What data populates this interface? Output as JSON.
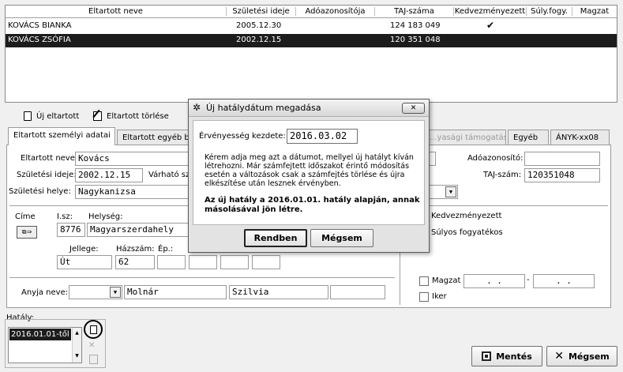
{
  "table": {
    "columns": [
      "Eltartott neve",
      "Születési ideje",
      "Adóazonosítója",
      "TAJ-száma",
      "Kedvezményezett",
      "Súly.fogy.",
      "Magzat"
    ],
    "rows": [
      {
        "name": "KOVÁCS BIANKA",
        "birth": "2005.12.30",
        "tax": "",
        "taj": "124 183 049",
        "kedv": "✔",
        "suly": "",
        "magzat": ""
      },
      {
        "name": "KOVÁCS ZSÓFIA",
        "birth": "2002.12.15",
        "tax": "",
        "taj": "120 351 048",
        "kedv": "",
        "suly": "",
        "magzat": ""
      }
    ]
  },
  "toolbar": {
    "new_label": "Új eltartott",
    "delete_label": "Eltartott törlése"
  },
  "tabs": [
    "Eltartott személyi adatai",
    "Eltartott egyéb be",
    "...yasági támogatás",
    "Egyéb",
    "ÁNYK-xx08"
  ],
  "form": {
    "name_label": "Eltartott neve:",
    "name_value": "Kovács",
    "birth_label": "Születési ideje:",
    "birth_value": "2002.12.15",
    "expected_label": "Várható sz",
    "birthplace_label": "Születési helye:",
    "birthplace_value": "Nagykanizsa",
    "tax_label": "Adóazonosító:",
    "tax_value": "",
    "taj_label": "TAJ-szám:",
    "taj_value": "120351048",
    "address_label": "Címe",
    "zip_label": "I.sz:",
    "zip_value": "8776",
    "city_label": "Helység:",
    "city_value": "Magyarszerdahely",
    "type_label": "Jellege:",
    "type_value": "Út",
    "house_label": "Házszám:",
    "house_value": "62",
    "building_label": "Ép.:",
    "mother_label": "Anyja neve:",
    "mother_last": "Molnár",
    "mother_first": "Szilvia",
    "kedv_label": "Kedvezményezett",
    "suly_label": "Súlyos fogyatékos",
    "magzat_label": "Magzat",
    "iker_label": "Iker",
    "date_mask": ". ."
  },
  "hatalyok": {
    "label": "Hatály:",
    "items": [
      "2016.01.01-től"
    ]
  },
  "buttons": {
    "save": "Mentés",
    "cancel": "Mégsem"
  },
  "dialog": {
    "title": "Új hatálydátum megadása",
    "field_label": "Érvényesség kezdete:",
    "field_value": "2016.03.02",
    "info": "Kérem adja meg azt a dátumot, mellyel új hatályt kíván létrehozni. Már számfejtett időszakot érintő módosítás esetén a változások csak a számfejtés törlése és újra elkészítése után lesznek érvényben.",
    "note": "Az új hatály a 2016.01.01. hatály alapján, annak másolásával jön létre.",
    "ok": "Rendben",
    "cancel": "Mégsem"
  }
}
